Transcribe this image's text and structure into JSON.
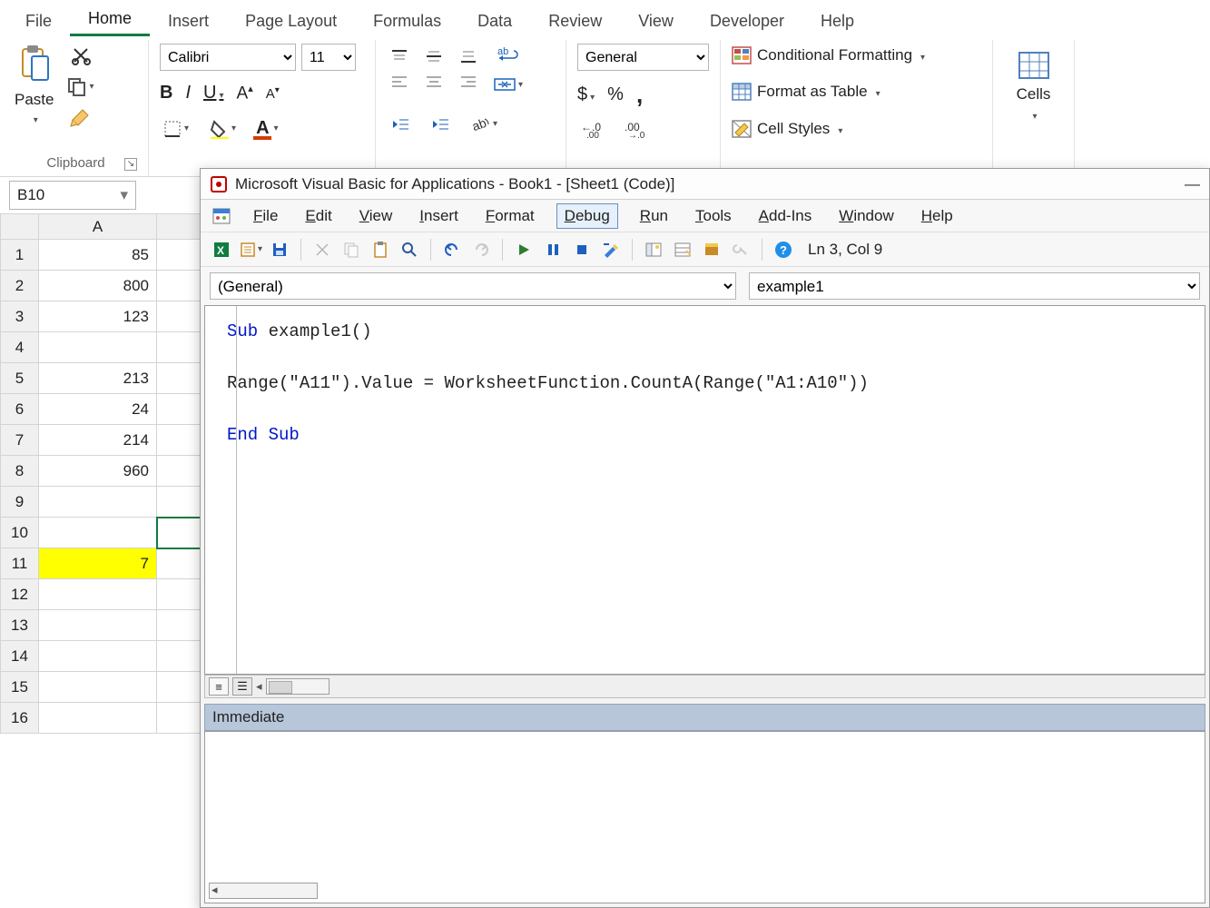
{
  "ribbonTabs": [
    "File",
    "Home",
    "Insert",
    "Page Layout",
    "Formulas",
    "Data",
    "Review",
    "View",
    "Developer",
    "Help"
  ],
  "activeRibbonTab": "Home",
  "clipboard": {
    "groupLabel": "Clipboard",
    "paste": "Paste"
  },
  "font": {
    "name": "Calibri",
    "size": "11",
    "bold": "B",
    "italic": "I",
    "underline": "U"
  },
  "number": {
    "format": "General",
    "currency": "$",
    "percent": "%",
    "comma": ","
  },
  "styles": {
    "condFmt": "Conditional Formatting",
    "tableFmt": "Format as Table",
    "cellStyles": "Cell Styles"
  },
  "cells": {
    "label": "Cells"
  },
  "nameBox": "B10",
  "columns": [
    "A"
  ],
  "rows": [
    {
      "n": 1,
      "A": "85"
    },
    {
      "n": 2,
      "A": "800"
    },
    {
      "n": 3,
      "A": "123"
    },
    {
      "n": 4,
      "A": ""
    },
    {
      "n": 5,
      "A": "213"
    },
    {
      "n": 6,
      "A": "24"
    },
    {
      "n": 7,
      "A": "214"
    },
    {
      "n": 8,
      "A": "960"
    },
    {
      "n": 9,
      "A": ""
    },
    {
      "n": 10,
      "A": ""
    },
    {
      "n": 11,
      "A": "7",
      "hl": true
    },
    {
      "n": 12,
      "A": ""
    },
    {
      "n": 13,
      "A": ""
    },
    {
      "n": 14,
      "A": ""
    },
    {
      "n": 15,
      "A": ""
    },
    {
      "n": 16,
      "A": ""
    }
  ],
  "selectedCell": "B10",
  "vbe": {
    "title": "Microsoft Visual Basic for Applications - Book1 - [Sheet1 (Code)]",
    "menu": [
      "File",
      "Edit",
      "View",
      "Insert",
      "Format",
      "Debug",
      "Run",
      "Tools",
      "Add-Ins",
      "Window",
      "Help"
    ],
    "activeMenu": "Debug",
    "cursor": "Ln 3, Col 9",
    "comboLeft": "(General)",
    "comboRight": "example1",
    "code": "Sub example1()\n\nRange(\"A11\").Value = WorksheetFunction.CountA(Range(\"A1:A10\"))\n\nEnd Sub",
    "immediateLabel": "Immediate"
  }
}
